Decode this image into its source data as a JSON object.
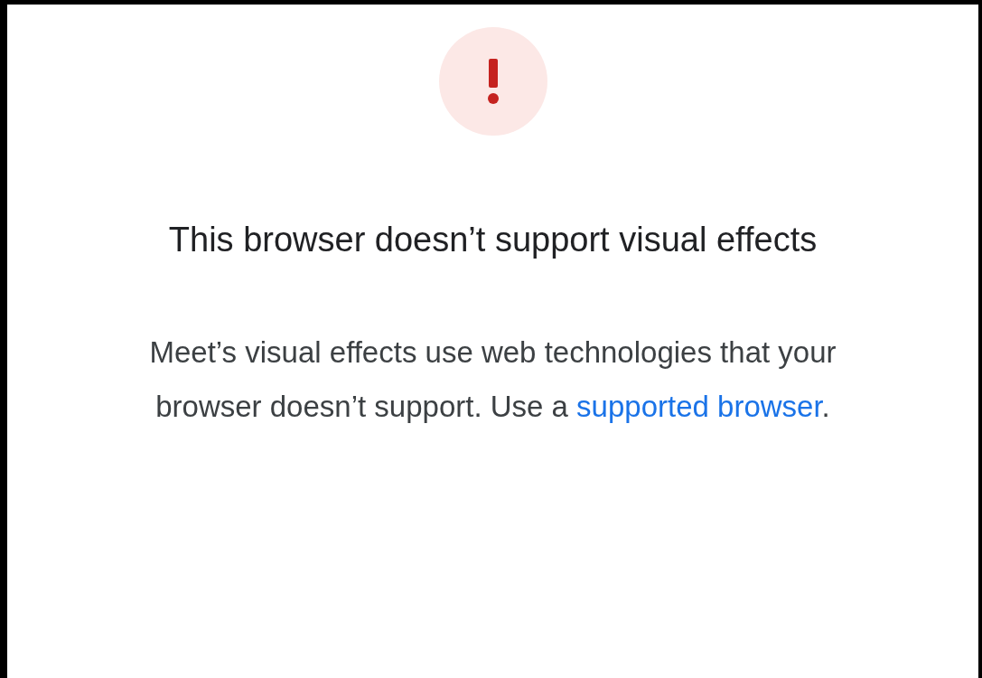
{
  "dialog": {
    "title": "This browser doesn’t support visual effects",
    "message": {
      "text": "Meet’s visual effects use web technologies that your browser doesn’t support. Use a ",
      "link": "supported browser",
      "text_after": "."
    }
  }
}
